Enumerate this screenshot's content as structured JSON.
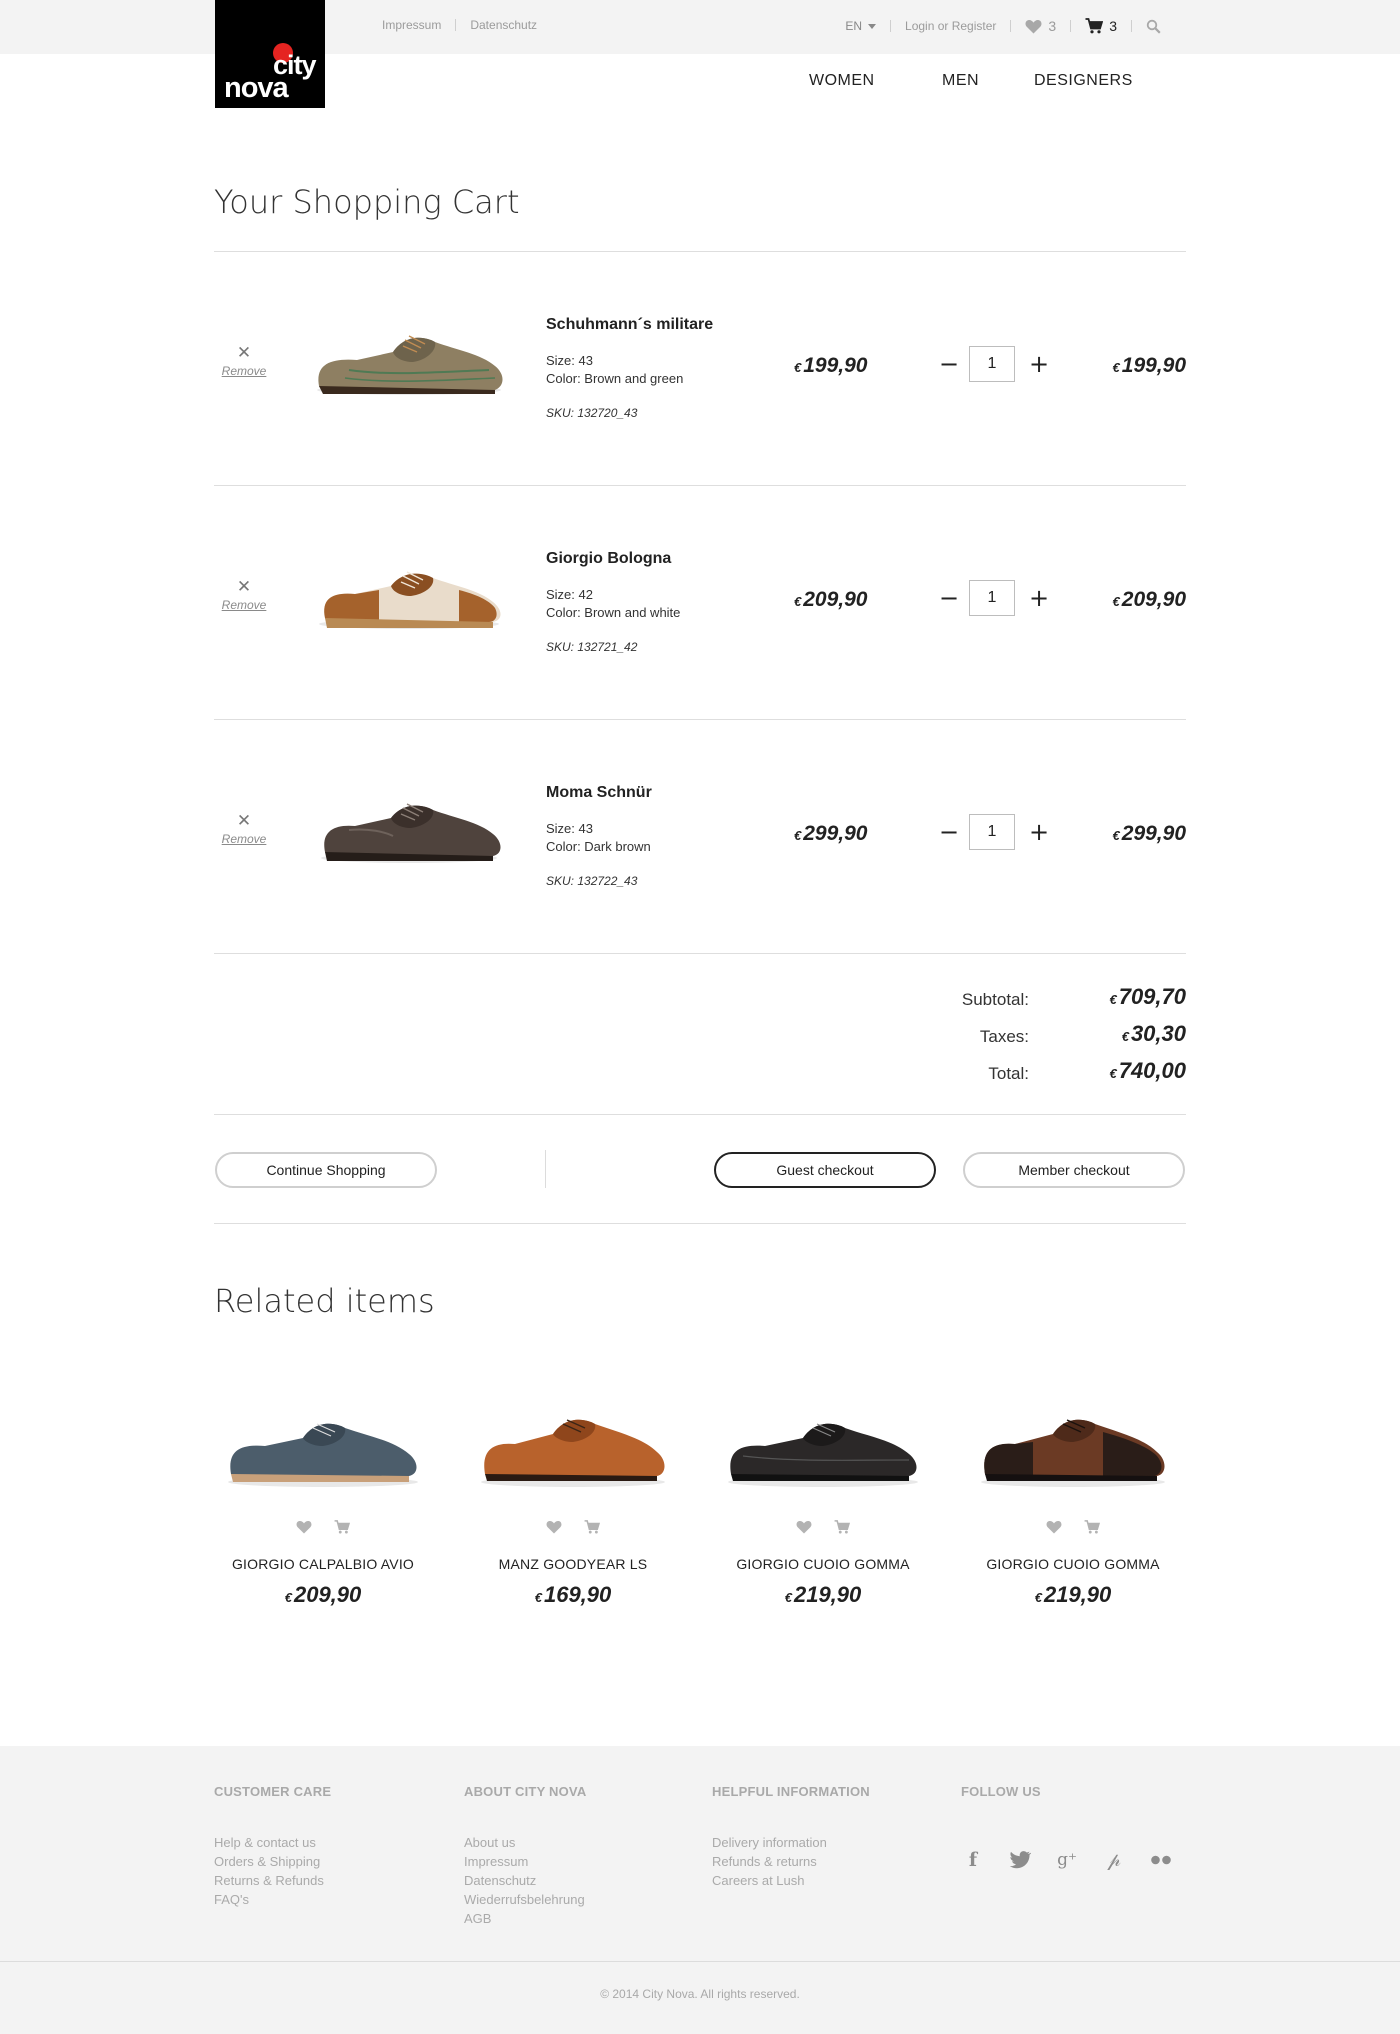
{
  "header": {
    "logo_top": "city",
    "logo_bottom": "nova",
    "links": [
      "Impressum",
      "Datenschutz"
    ],
    "language": "EN",
    "login": "Login or Register",
    "wishlist_count": "3",
    "cart_count": "3"
  },
  "nav": [
    "WOMEN",
    "MEN",
    "DESIGNERS"
  ],
  "cart": {
    "title": "Your Shopping Cart",
    "remove_label": "Remove",
    "currency": "€",
    "items": [
      {
        "name": "Schuhmann´s militare",
        "size": "Size: 43",
        "color": "Color: Brown and green",
        "sku": "SKU: 132720_43",
        "price": "199,90",
        "qty": "1",
        "total": "199,90"
      },
      {
        "name": "Giorgio Bologna",
        "size": "Size: 42",
        "color": "Color: Brown and white",
        "sku": "SKU: 132721_42",
        "price": "209,90",
        "qty": "1",
        "total": "209,90"
      },
      {
        "name": "Moma Schnür",
        "size": "Size: 43",
        "color": "Color: Dark brown",
        "sku": "SKU: 132722_43",
        "price": "299,90",
        "qty": "1",
        "total": "299,90"
      }
    ],
    "summary": {
      "subtotal_label": "Subtotal:",
      "subtotal": "709,70",
      "taxes_label": "Taxes:",
      "taxes": "30,30",
      "total_label": "Total:",
      "total": "740,00"
    },
    "buttons": {
      "continue": "Continue Shopping",
      "guest": "Guest checkout",
      "member": "Member checkout"
    }
  },
  "related": {
    "title": "Related items",
    "items": [
      {
        "name": "GIORGIO CALPALBIO AVIO",
        "price": "209,90"
      },
      {
        "name": "MANZ GOODYEAR LS",
        "price": "169,90"
      },
      {
        "name": "GIORGIO CUOIO GOMMA",
        "price": "219,90"
      },
      {
        "name": "GIORGIO CUOIO GOMMA",
        "price": "219,90"
      }
    ]
  },
  "footer": {
    "columns": [
      {
        "heading": "CUSTOMER CARE",
        "links": [
          "Help & contact us",
          "Orders & Shipping",
          "Returns & Refunds",
          "FAQ's"
        ]
      },
      {
        "heading": "ABOUT CITY NOVA",
        "links": [
          "About us",
          "Impressum",
          "Datenschutz",
          "Wiederrufsbelehrung",
          "AGB"
        ]
      },
      {
        "heading": "HELPFUL INFORMATION",
        "links": [
          "Delivery information",
          "Refunds & returns",
          "Careers at Lush"
        ]
      },
      {
        "heading": "FOLLOW US",
        "links": []
      }
    ],
    "social": [
      "facebook-icon",
      "twitter-icon",
      "google-plus-icon",
      "pinterest-icon",
      "flickr-icon"
    ],
    "copyright": "© 2014 City Nova. All rights reserved."
  },
  "colors": {
    "accent_red": "#e52421",
    "text": "#222222",
    "muted": "#9b9b9b",
    "bar_bg": "#f3f3f3"
  }
}
